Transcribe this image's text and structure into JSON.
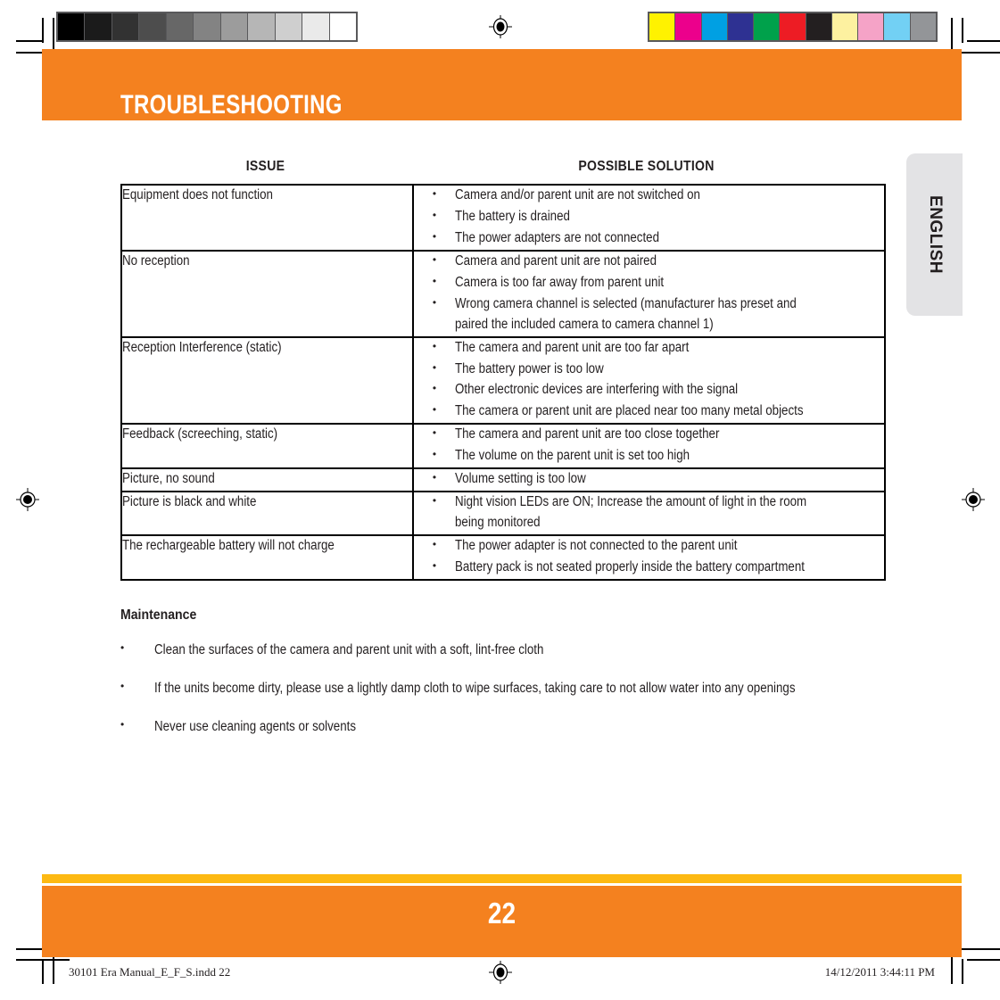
{
  "document": {
    "title": "TROUBLESHOOTING",
    "language_tab": "ENGLISH",
    "page_number": "22",
    "accent_orange": "#f4811f",
    "accent_yellow": "#fdb913",
    "tab_gray": "#e3e3e5",
    "text_color": "#231f20"
  },
  "table": {
    "headers": {
      "issue": "ISSUE",
      "solution": "POSSIBLE SOLUTION"
    },
    "rows": [
      {
        "issue": "Equipment does not function",
        "solutions": [
          "Camera and/or parent unit are not switched on",
          "The battery is drained",
          "The power adapters are not connected"
        ]
      },
      {
        "issue": "No reception",
        "solutions": [
          "Camera and parent unit are not paired",
          "Camera is too far away from parent unit",
          "Wrong camera channel is selected (manufacturer has preset and paired the included camera to camera channel 1)"
        ]
      },
      {
        "issue": "Reception Interference (static)",
        "solutions": [
          "The camera and parent unit are too far apart",
          "The battery power is too low",
          "Other electronic devices are interfering with the signal",
          "The camera or parent unit are placed near too many metal objects"
        ]
      },
      {
        "issue": "Feedback (screeching, static)",
        "solutions": [
          "The camera and parent unit are too close together",
          "The volume on the parent unit is set too high"
        ]
      },
      {
        "issue": "Picture, no sound",
        "solutions": [
          "Volume setting is too low"
        ]
      },
      {
        "issue": "Picture is black and white",
        "solutions": [
          "Night vision LEDs are ON; Increase the amount of light in the room being monitored"
        ]
      },
      {
        "issue": "The rechargeable battery will not charge",
        "solutions": [
          "The power adapter is not connected to the parent unit",
          "Battery pack is not seated properly inside the battery compartment"
        ]
      }
    ]
  },
  "maintenance": {
    "title": "Maintenance",
    "items": [
      "Clean the surfaces of the camera and parent unit with a soft, lint-free cloth",
      "If the units become dirty, please use a lightly damp cloth to wipe surfaces, taking care to not allow water into any openings",
      "Never use cleaning agents or solvents"
    ]
  },
  "footer": {
    "file_name": "30101 Era Manual_E_F_S.indd   22",
    "timestamp": "14/12/2011   3:44:11 PM"
  },
  "print_marks": {
    "grayscale_bar": [
      "#000000",
      "#1b1b1b",
      "#323232",
      "#4d4d4d",
      "#676767",
      "#838383",
      "#9c9c9c",
      "#b6b6b6",
      "#cfcfcf",
      "#eaeaea",
      "#ffffff"
    ],
    "color_bar": [
      "#fff200",
      "#ec008c",
      "#00a0e3",
      "#2e3192",
      "#00a14b",
      "#ed1c24",
      "#231f20",
      "#fdf1a0",
      "#f5a3c7",
      "#72d0f4",
      "#939598"
    ],
    "registration_icon": "registration-target-icon",
    "bullet_glyph": "•"
  }
}
